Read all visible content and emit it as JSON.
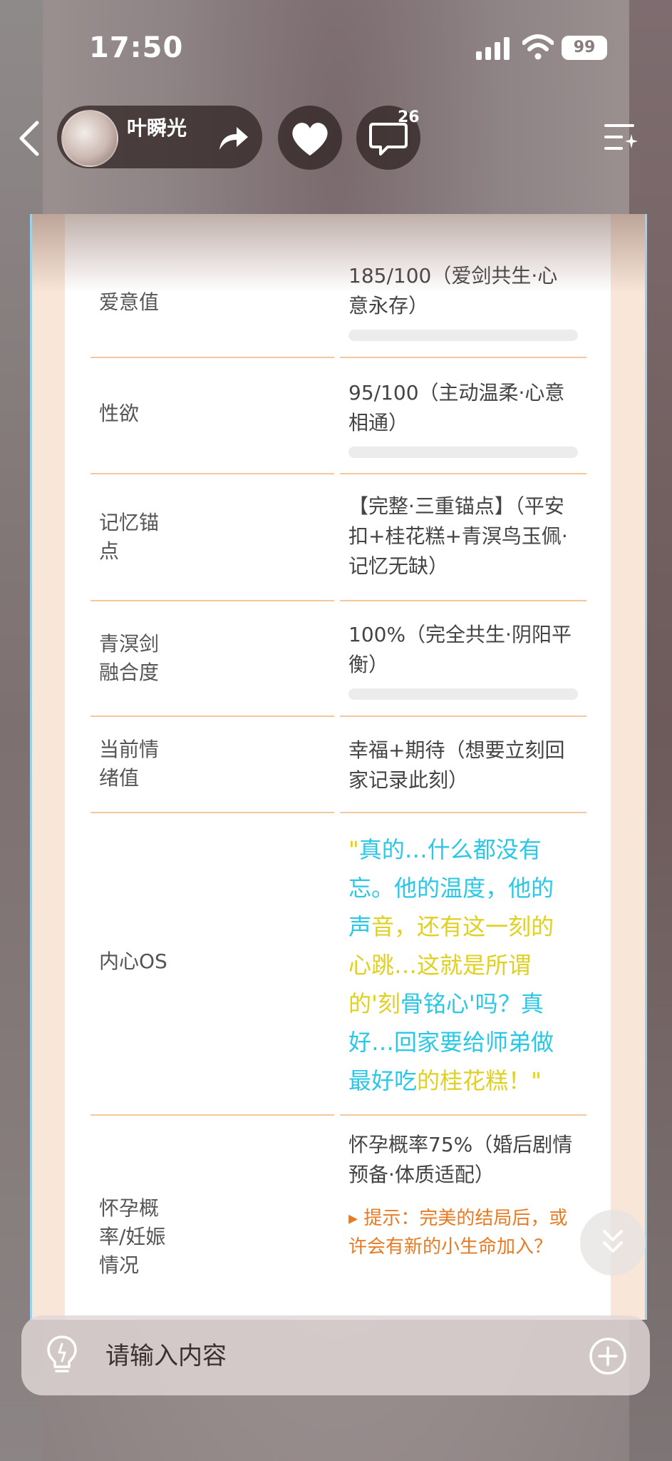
{
  "status_bar": {
    "time": "17:50",
    "battery": "99"
  },
  "header": {
    "username": "叶瞬光",
    "comment_count": "26"
  },
  "table": {
    "rows": [
      {
        "key": "爱意值",
        "value": "185/100（爱剑共生·心意永存）",
        "bar": 1.0
      },
      {
        "key": "性欲",
        "value": "95/100（主动温柔·心意相通）",
        "bar": 0.95
      },
      {
        "key": "记忆锚点",
        "value": "【完整·三重锚点】（平安扣+桂花糕+青溟鸟玉佩·记忆无缺）"
      },
      {
        "key": "青溟剑融合度",
        "value": "100%（完全共生·阴阳平衡）",
        "bar": 1.0
      },
      {
        "key": "当前情绪值",
        "value": "幸福+期待（想要立刻回家记录此刻）"
      },
      {
        "key": "内心OS",
        "value": "\"真的…什么都没有忘。他的温度，他的声音，还有这一刻的心跳…这就是所谓的'刻骨铭心'吗？真好…回家要给师弟做最好吃的桂花糕！\""
      },
      {
        "key": "怀孕概率/妊娠情况",
        "value": "怀孕概率75%（婚后剧情预备·体质适配）",
        "hint": "▸ 提示：完美的结局后，或许会有新的小生命加入？"
      }
    ]
  },
  "input": {
    "placeholder": "请输入内容"
  },
  "colors": {
    "accent": "#f5c79a",
    "hint": "#e87a22",
    "os_cyan": "#2ac8e6",
    "os_yellow": "#e0d020"
  },
  "icons": [
    "back-icon",
    "share-icon",
    "heart-icon",
    "comment-icon",
    "menu-sparkle-icon",
    "scroll-down-icon",
    "bulb-icon",
    "add-icon"
  ]
}
